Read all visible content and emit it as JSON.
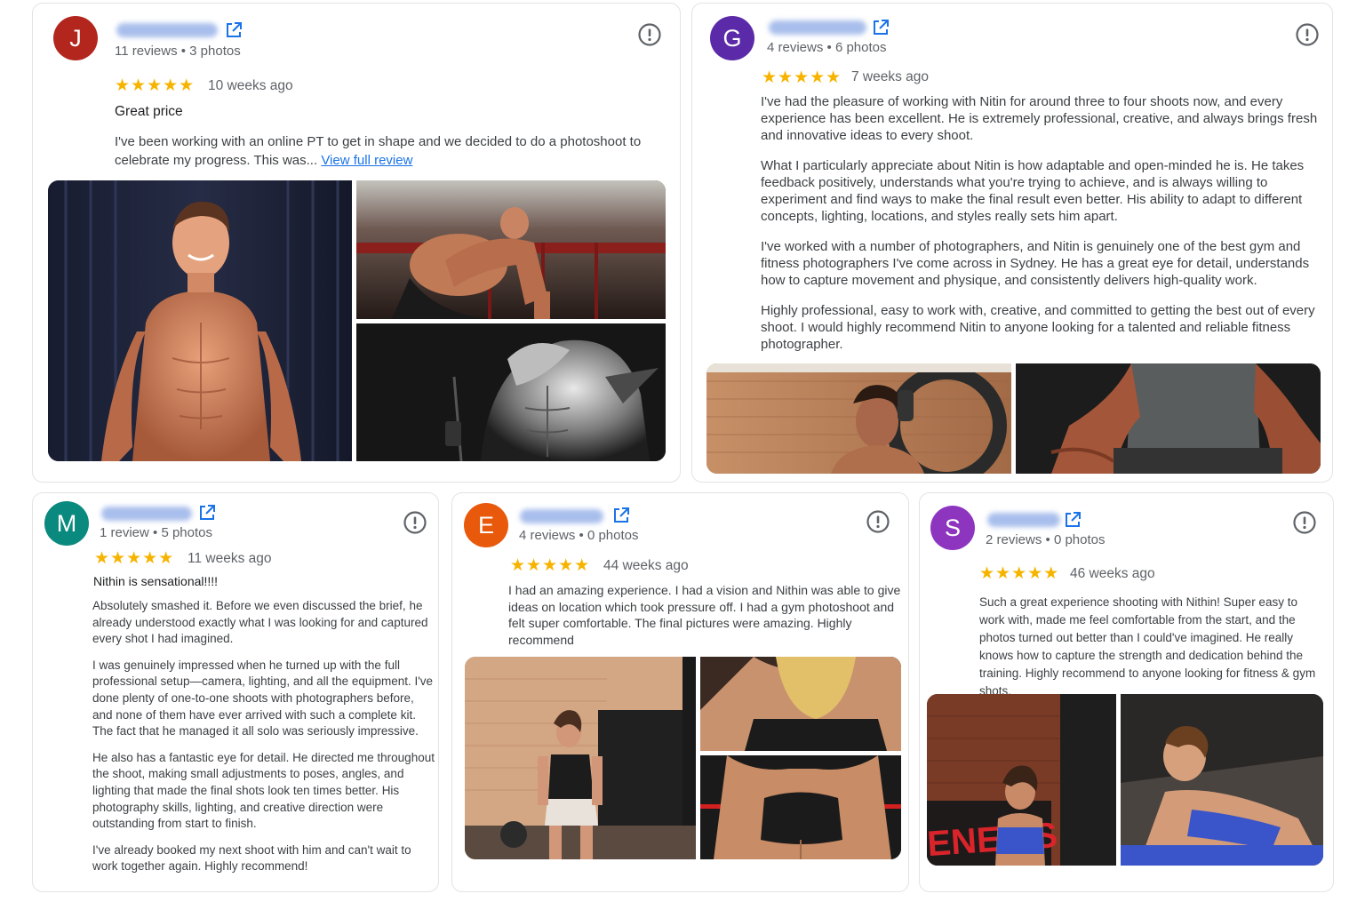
{
  "colors": {
    "star": "#f6b400",
    "link": "#1a73e8",
    "avatar_j": "#b3261e",
    "avatar_g": "#5b2aa8",
    "avatar_m": "#0a8a7e",
    "avatar_e": "#e8590c",
    "avatar_s": "#8e35c0"
  },
  "reviews": [
    {
      "initial": "J",
      "meta": "11 reviews • 3 photos",
      "stars": "★★★★★",
      "when": "10 weeks ago",
      "title": "Great price",
      "text": "I've been working with an online PT to get in shape and we decided to do a photoshoot to celebrate my progress. This was...",
      "more_link": "View full review",
      "photos": [
        "shirtless-man-portrait",
        "man-pushup-gym",
        "bw-man-cable-curl"
      ]
    },
    {
      "initial": "G",
      "meta": "4 reviews • 6 photos",
      "stars": "★★★★★",
      "when": "7 weeks ago",
      "paragraphs": [
        "I've had the pleasure of working with Nitin for around three to four shoots now, and every experience has been excellent. He is extremely professional, creative, and always brings fresh and innovative ideas to every shoot.",
        "What I particularly appreciate about Nitin is how adaptable and open-minded he is. He takes feedback positively, understands what you're trying to achieve, and is always willing to experiment and find ways to make the final result even better. His ability to adapt to different concepts, lighting, locations, and styles really sets him apart.",
        "I've worked with a number of photographers, and Nitin is genuinely one of the best gym and fitness photographers I've come across in Sydney. He has a great eye for detail, understands how to capture movement and physique, and consistently delivers high-quality work.",
        "Highly professional, easy to work with, creative, and committed to getting the best out of every shoot. I would highly recommend Nitin to anyone looking for a talented and reliable fitness photographer."
      ],
      "photos": [
        "man-on-bike-gym",
        "man-seated-tank-top"
      ]
    },
    {
      "initial": "M",
      "meta": "1 review • 5 photos",
      "stars": "★★★★★",
      "when": "11 weeks ago",
      "title": "Nithin is sensational!!!!",
      "paragraphs": [
        "Absolutely smashed it. Before we even discussed the brief, he already understood exactly what I was looking for and captured every shot I had imagined.",
        "I was genuinely impressed when he turned up with the full professional setup—camera, lighting, and all the equipment. I've done plenty of one-to-one shoots with photographers before, and none of them have ever arrived with such a complete kit. The fact that he managed it all solo was seriously impressive.",
        "He also has a fantastic eye for detail. He directed me throughout the shoot, making small adjustments to poses, angles, and lighting that made the final shots look ten times better. His photography skills, lighting, and creative direction were outstanding from start to finish.",
        "I've already booked my next shoot with him and can't wait to work together again. Highly recommend!"
      ]
    },
    {
      "initial": "E",
      "meta": "4 reviews • 0 photos",
      "stars": "★★★★★",
      "when": "44 weeks ago",
      "text": "I had an amazing experience. I had a vision and Nithin was able to give ideas on location which took pressure off. I had a gym photoshoot and felt super comfortable. The final pictures were amazing. Highly recommend",
      "photos": [
        "woman-walking-gym",
        "woman-pushup",
        "woman-sports-bra"
      ]
    },
    {
      "initial": "S",
      "meta": "2 reviews • 0 photos",
      "stars": "★★★★★",
      "when": "46 weeks ago",
      "text": "Such a great experience shooting with Nithin! Super easy to work with, made me feel comfortable from the start, and the photos turned out better than I could've imagined. He really knows how to capture the strength and dedication behind the training. Highly recommend to anyone looking for fitness & gym shots.",
      "photo_sign_text": "ENESIS",
      "photos": [
        "woman-genesis-sign",
        "woman-situp"
      ]
    }
  ]
}
